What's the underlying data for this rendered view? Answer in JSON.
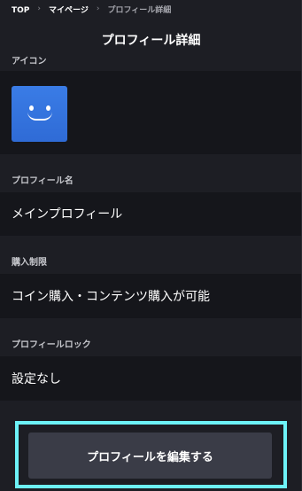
{
  "breadcrumb": {
    "items": [
      "TOP",
      "マイページ",
      "プロフィール詳細"
    ],
    "separator": "›"
  },
  "page": {
    "title": "プロフィール詳細"
  },
  "sections": {
    "icon": {
      "label": "アイコン",
      "avatar_icon": "smiley-face-icon",
      "avatar_color": "#3a7ce6"
    },
    "profile_name": {
      "label": "プロフィール名",
      "value": "メインプロフィール"
    },
    "purchase_limit": {
      "label": "購入制限",
      "value": "コイン購入・コンテンツ購入が可能"
    },
    "profile_lock": {
      "label": "プロフィールロック",
      "value": "設定なし"
    }
  },
  "actions": {
    "edit_label": "プロフィールを編集する",
    "highlight_color": "#6df3f8"
  }
}
